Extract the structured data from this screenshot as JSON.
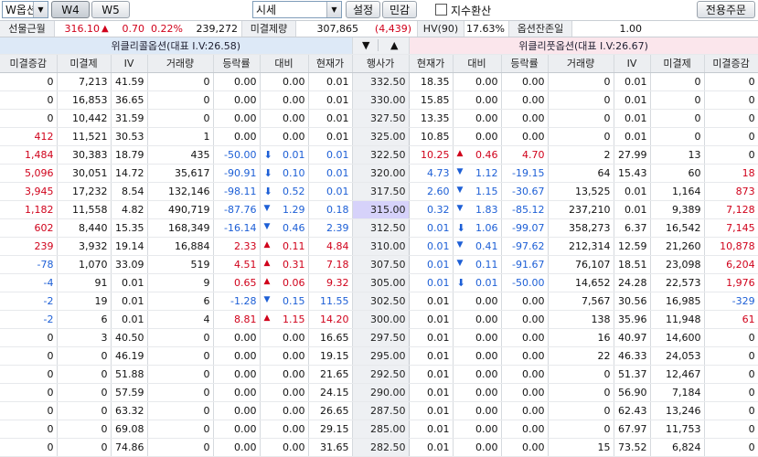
{
  "toolbar": {
    "product_value": "W옵션",
    "tab_w4": "W4",
    "tab_w5": "W5",
    "view_value": "시세",
    "settings_label": "설정",
    "sensitivity_label": "민감",
    "index_convert_label": "지수환산",
    "dedicated_order_label": "전용주문"
  },
  "info": {
    "futures_label": "선물근월",
    "futures_price": "316.10",
    "futures_change": "0.70",
    "futures_rate": "0.22%",
    "futures_volume": "239,272",
    "oi_label": "미결제량",
    "oi_value": "307,865",
    "oi_change": "(4,439)",
    "hv_label": "HV(90)",
    "hv_value": "17.63%",
    "days_label": "옵션잔존일",
    "days_value": "1.00"
  },
  "group": {
    "call_title": "위클리콜옵션(대표 I.V:26.58)",
    "put_title": "위클리풋옵션(대표 I.V:26.67)",
    "down_arrow": "▼",
    "up_arrow": "▲"
  },
  "headers": {
    "call": [
      "미결증감",
      "미결제",
      "IV",
      "거래량",
      "등락률",
      "대비",
      "현재가"
    ],
    "strike": "행사가",
    "put": [
      "현재가",
      "대비",
      "등락률",
      "거래량",
      "IV",
      "미결제",
      "미결증감"
    ]
  },
  "colors": {
    "up": "#d0021b",
    "down": "#1d5fd6",
    "atm_highlight": "#d6d2fa"
  },
  "rows": [
    {
      "coi_chg": "0",
      "coi": "7,213",
      "civ": "41.59",
      "cvol": "0",
      "crate": "0.00",
      "cdiff": "0.00",
      "cprice": "0.01",
      "strike": "332.50",
      "pprice": "18.35",
      "pdiff": "0.00",
      "prate": "0.00",
      "pvol": "0",
      "piv": "0.01",
      "poi": "0",
      "poi_chg": "0"
    },
    {
      "coi_chg": "0",
      "coi": "16,853",
      "civ": "36.65",
      "cvol": "0",
      "crate": "0.00",
      "cdiff": "0.00",
      "cprice": "0.01",
      "strike": "330.00",
      "pprice": "15.85",
      "pdiff": "0.00",
      "prate": "0.00",
      "pvol": "0",
      "piv": "0.01",
      "poi": "0",
      "poi_chg": "0"
    },
    {
      "coi_chg": "0",
      "coi": "10,442",
      "civ": "31.59",
      "cvol": "0",
      "crate": "0.00",
      "cdiff": "0.00",
      "cprice": "0.01",
      "strike": "327.50",
      "pprice": "13.35",
      "pdiff": "0.00",
      "prate": "0.00",
      "pvol": "0",
      "piv": "0.01",
      "poi": "0",
      "poi_chg": "0"
    },
    {
      "coi_chg": "412",
      "coi": "11,521",
      "civ": "30.53",
      "cvol": "1",
      "crate": "0.00",
      "cdiff": "0.00",
      "cprice": "0.01",
      "strike": "325.00",
      "pprice": "10.85",
      "pdiff": "0.00",
      "prate": "0.00",
      "pvol": "0",
      "piv": "0.01",
      "poi": "0",
      "poi_chg": "0"
    },
    {
      "coi_chg": "1,484",
      "coi": "30,383",
      "civ": "18.79",
      "cvol": "435",
      "crate": "-50.00",
      "cdiff": "0.01",
      "cprice": "0.01",
      "strike": "322.50",
      "pprice": "10.25",
      "pdiff": "0.46",
      "prate": "4.70",
      "pvol": "2",
      "piv": "27.99",
      "poi": "13",
      "poi_chg": "0"
    },
    {
      "coi_chg": "5,096",
      "coi": "30,051",
      "civ": "14.72",
      "cvol": "35,617",
      "crate": "-90.91",
      "cdiff": "0.10",
      "cprice": "0.01",
      "strike": "320.00",
      "pprice": "4.73",
      "pdiff": "1.12",
      "prate": "-19.15",
      "pvol": "64",
      "piv": "15.43",
      "poi": "60",
      "poi_chg": "18"
    },
    {
      "coi_chg": "3,945",
      "coi": "17,232",
      "civ": "8.54",
      "cvol": "132,146",
      "crate": "-98.11",
      "cdiff": "0.52",
      "cprice": "0.01",
      "strike": "317.50",
      "pprice": "2.60",
      "pdiff": "1.15",
      "prate": "-30.67",
      "pvol": "13,525",
      "piv": "0.01",
      "poi": "1,164",
      "poi_chg": "873"
    },
    {
      "coi_chg": "1,182",
      "coi": "11,558",
      "civ": "4.82",
      "cvol": "490,719",
      "crate": "-87.76",
      "cdiff": "1.29",
      "cprice": "0.18",
      "strike": "315.00",
      "pprice": "0.32",
      "pdiff": "1.83",
      "prate": "-85.12",
      "pvol": "237,210",
      "piv": "0.01",
      "poi": "9,389",
      "poi_chg": "7,128"
    },
    {
      "coi_chg": "602",
      "coi": "8,440",
      "civ": "15.35",
      "cvol": "168,349",
      "crate": "-16.14",
      "cdiff": "0.46",
      "cprice": "2.39",
      "strike": "312.50",
      "pprice": "0.01",
      "pdiff": "1.06",
      "prate": "-99.07",
      "pvol": "358,273",
      "piv": "6.37",
      "poi": "16,542",
      "poi_chg": "7,145"
    },
    {
      "coi_chg": "239",
      "coi": "3,932",
      "civ": "19.14",
      "cvol": "16,884",
      "crate": "2.33",
      "cdiff": "0.11",
      "cprice": "4.84",
      "strike": "310.00",
      "pprice": "0.01",
      "pdiff": "0.41",
      "prate": "-97.62",
      "pvol": "212,314",
      "piv": "12.59",
      "poi": "21,260",
      "poi_chg": "10,878"
    },
    {
      "coi_chg": "-78",
      "coi": "1,070",
      "civ": "33.09",
      "cvol": "519",
      "crate": "4.51",
      "cdiff": "0.31",
      "cprice": "7.18",
      "strike": "307.50",
      "pprice": "0.01",
      "pdiff": "0.11",
      "prate": "-91.67",
      "pvol": "76,107",
      "piv": "18.51",
      "poi": "23,098",
      "poi_chg": "6,204"
    },
    {
      "coi_chg": "-4",
      "coi": "91",
      "civ": "0.01",
      "cvol": "9",
      "crate": "0.65",
      "cdiff": "0.06",
      "cprice": "9.32",
      "strike": "305.00",
      "pprice": "0.01",
      "pdiff": "0.01",
      "prate": "-50.00",
      "pvol": "14,652",
      "piv": "24.28",
      "poi": "22,573",
      "poi_chg": "1,976"
    },
    {
      "coi_chg": "-2",
      "coi": "19",
      "civ": "0.01",
      "cvol": "6",
      "crate": "-1.28",
      "cdiff": "0.15",
      "cprice": "11.55",
      "strike": "302.50",
      "pprice": "0.01",
      "pdiff": "0.00",
      "prate": "0.00",
      "pvol": "7,567",
      "piv": "30.56",
      "poi": "16,985",
      "poi_chg": "-329"
    },
    {
      "coi_chg": "-2",
      "coi": "6",
      "civ": "0.01",
      "cvol": "4",
      "crate": "8.81",
      "cdiff": "1.15",
      "cprice": "14.20",
      "strike": "300.00",
      "pprice": "0.01",
      "pdiff": "0.00",
      "prate": "0.00",
      "pvol": "138",
      "piv": "35.96",
      "poi": "11,948",
      "poi_chg": "61"
    },
    {
      "coi_chg": "0",
      "coi": "3",
      "civ": "40.50",
      "cvol": "0",
      "crate": "0.00",
      "cdiff": "0.00",
      "cprice": "16.65",
      "strike": "297.50",
      "pprice": "0.01",
      "pdiff": "0.00",
      "prate": "0.00",
      "pvol": "16",
      "piv": "40.97",
      "poi": "14,600",
      "poi_chg": "0"
    },
    {
      "coi_chg": "0",
      "coi": "0",
      "civ": "46.19",
      "cvol": "0",
      "crate": "0.00",
      "cdiff": "0.00",
      "cprice": "19.15",
      "strike": "295.00",
      "pprice": "0.01",
      "pdiff": "0.00",
      "prate": "0.00",
      "pvol": "22",
      "piv": "46.33",
      "poi": "24,053",
      "poi_chg": "0"
    },
    {
      "coi_chg": "0",
      "coi": "0",
      "civ": "51.88",
      "cvol": "0",
      "crate": "0.00",
      "cdiff": "0.00",
      "cprice": "21.65",
      "strike": "292.50",
      "pprice": "0.01",
      "pdiff": "0.00",
      "prate": "0.00",
      "pvol": "0",
      "piv": "51.37",
      "poi": "12,467",
      "poi_chg": "0"
    },
    {
      "coi_chg": "0",
      "coi": "0",
      "civ": "57.59",
      "cvol": "0",
      "crate": "0.00",
      "cdiff": "0.00",
      "cprice": "24.15",
      "strike": "290.00",
      "pprice": "0.01",
      "pdiff": "0.00",
      "prate": "0.00",
      "pvol": "0",
      "piv": "56.90",
      "poi": "7,184",
      "poi_chg": "0"
    },
    {
      "coi_chg": "0",
      "coi": "0",
      "civ": "63.32",
      "cvol": "0",
      "crate": "0.00",
      "cdiff": "0.00",
      "cprice": "26.65",
      "strike": "287.50",
      "pprice": "0.01",
      "pdiff": "0.00",
      "prate": "0.00",
      "pvol": "0",
      "piv": "62.43",
      "poi": "13,246",
      "poi_chg": "0"
    },
    {
      "coi_chg": "0",
      "coi": "0",
      "civ": "69.08",
      "cvol": "0",
      "crate": "0.00",
      "cdiff": "0.00",
      "cprice": "29.15",
      "strike": "285.00",
      "pprice": "0.01",
      "pdiff": "0.00",
      "prate": "0.00",
      "pvol": "0",
      "piv": "67.97",
      "poi": "11,753",
      "poi_chg": "0"
    },
    {
      "coi_chg": "0",
      "coi": "0",
      "civ": "74.86",
      "cvol": "0",
      "crate": "0.00",
      "cdiff": "0.00",
      "cprice": "31.65",
      "strike": "282.50",
      "pprice": "0.01",
      "pdiff": "0.00",
      "prate": "0.00",
      "pvol": "15",
      "piv": "73.52",
      "poi": "6,824",
      "poi_chg": "0"
    }
  ],
  "row_style": [
    {},
    {},
    {},
    {
      "coi_chg": "red"
    },
    {
      "coi_chg": "red",
      "crate": "blue",
      "cdiff": "dnb blue",
      "cprice": "blue",
      "pprice": "red",
      "pdiff": "up red",
      "prate": "red"
    },
    {
      "coi_chg": "red",
      "crate": "blue",
      "cdiff": "dnb blue",
      "cprice": "blue",
      "pprice": "blue",
      "pdiff": "dn blue",
      "prate": "blue",
      "poi_chg": "red"
    },
    {
      "coi_chg": "red",
      "crate": "blue",
      "cdiff": "dnb blue",
      "cprice": "blue",
      "pprice": "blue",
      "pdiff": "dn blue",
      "prate": "blue",
      "poi_chg": "red"
    },
    {
      "coi_chg": "red",
      "crate": "blue",
      "cdiff": "dn blue",
      "cprice": "blue",
      "pprice": "blue",
      "pdiff": "dn blue",
      "prate": "blue",
      "poi_chg": "red",
      "strike": "atm"
    },
    {
      "coi_chg": "red",
      "crate": "blue",
      "cdiff": "dn blue",
      "cprice": "blue",
      "pprice": "blue",
      "pdiff": "dnb blue",
      "prate": "blue",
      "poi_chg": "red"
    },
    {
      "coi_chg": "red",
      "crate": "red",
      "cdiff": "up red",
      "cprice": "red",
      "pprice": "blue",
      "pdiff": "dn blue",
      "prate": "blue",
      "poi_chg": "red"
    },
    {
      "coi_chg": "blue",
      "crate": "red",
      "cdiff": "up red",
      "cprice": "red",
      "pprice": "blue",
      "pdiff": "dn blue",
      "prate": "blue",
      "poi_chg": "red"
    },
    {
      "coi_chg": "blue",
      "crate": "red",
      "cdiff": "up red",
      "cprice": "red",
      "pprice": "blue",
      "pdiff": "dnb blue",
      "prate": "blue",
      "poi_chg": "red"
    },
    {
      "coi_chg": "blue",
      "crate": "blue",
      "cdiff": "dn blue",
      "cprice": "blue",
      "poi_chg": "blue"
    },
    {
      "coi_chg": "blue",
      "crate": "red",
      "cdiff": "up red",
      "cprice": "red",
      "poi_chg": "red"
    },
    {},
    {},
    {},
    {},
    {},
    {},
    {}
  ]
}
